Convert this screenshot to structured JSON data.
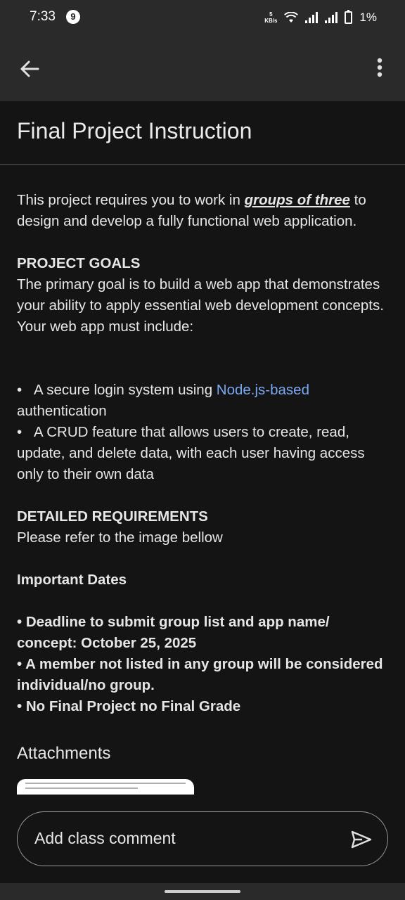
{
  "status_bar": {
    "time": "7:33",
    "notification_count": "9",
    "net_speed_value": "5",
    "net_speed_unit": "KB/s",
    "battery": "1%"
  },
  "app_bar": {
    "back_icon": "arrow-back-icon",
    "menu_icon": "more-vert-icon"
  },
  "title": "Final Project Instruction",
  "intro": {
    "before": "This project requires you to work in ",
    "emphasis": "groups of three",
    "after": " to design and develop a fully functional web application."
  },
  "goals": {
    "heading": "PROJECT GOALS",
    "text": "The primary goal is to build a web app that demonstrates your ability to apply essential web development concepts. Your web app must include:"
  },
  "bullets": [
    {
      "before": "A secure login system using ",
      "link": "Node.js-based",
      "after": " authentication"
    },
    {
      "text": "A CRUD feature that allows users to create, read, update, and delete data, with each user having access only to their own data"
    }
  ],
  "requirements": {
    "heading": "DETAILED REQUIREMENTS",
    "text": "Please refer to the image bellow"
  },
  "dates": {
    "heading": "Important Dates",
    "items": [
      "• Deadline to submit group list and app name/ concept: October 25, 2025",
      "• A member not listed in any group will be considered individual/no group.",
      "• No Final Project no Final Grade"
    ]
  },
  "attachments_heading": "Attachments",
  "comment": {
    "placeholder": "Add class comment",
    "send_icon": "send-icon"
  },
  "colors": {
    "background": "#141414",
    "bar": "#2a2a2a",
    "link": "#7aa7f0"
  }
}
